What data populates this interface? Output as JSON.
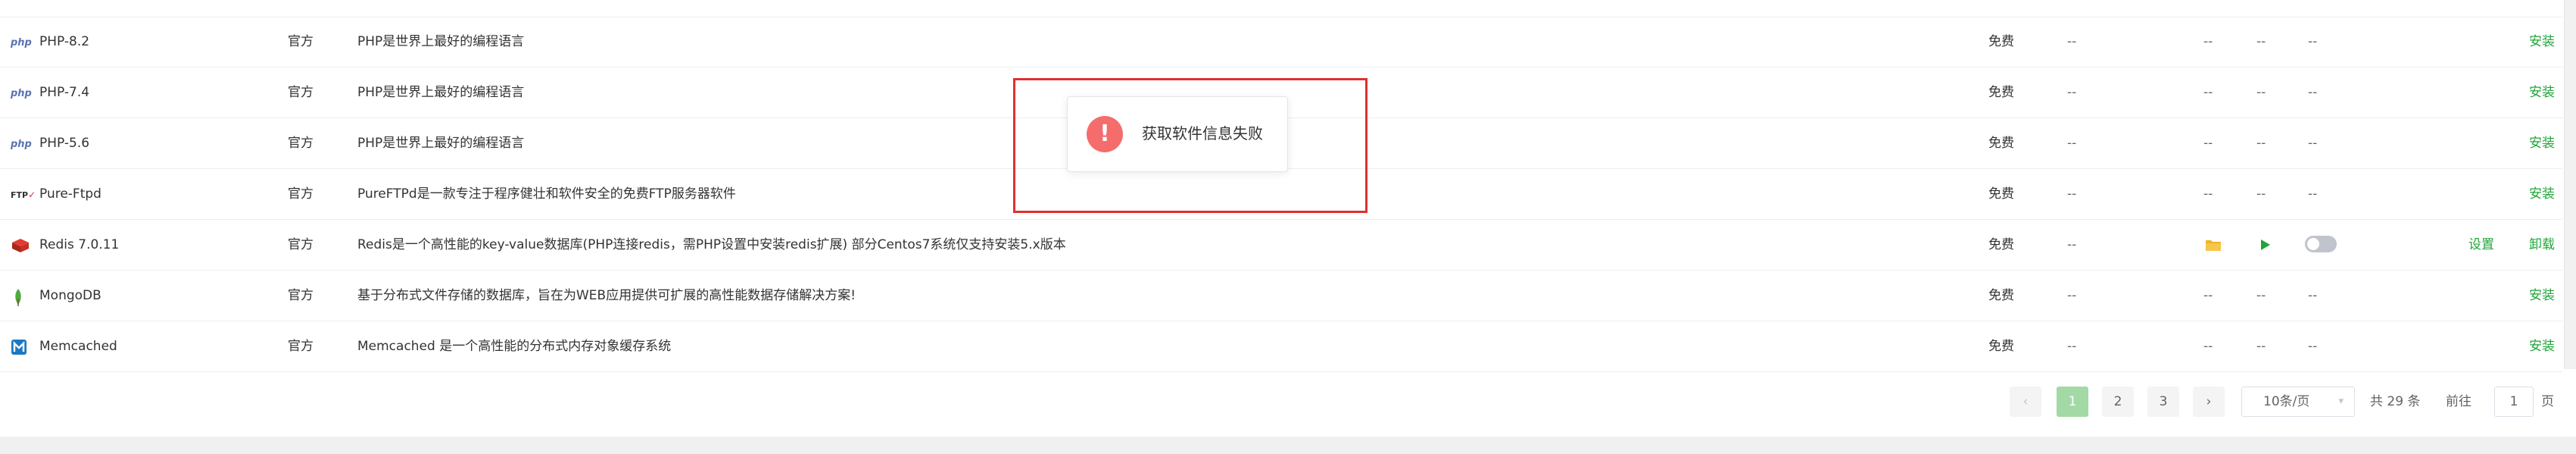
{
  "rows": [
    {
      "name": "PHP-8.2",
      "type": "官方",
      "desc": "PHP是世界上最好的编程语言",
      "price": "免费",
      "d1": "--",
      "d2": "--",
      "d3": "--",
      "d4": "--",
      "action": "安装",
      "icon": "php-icon"
    },
    {
      "name": "PHP-7.4",
      "type": "官方",
      "desc": "PHP是世界上最好的编程语言",
      "price": "免费",
      "d1": "--",
      "d2": "--",
      "d3": "--",
      "d4": "--",
      "action": "安装",
      "icon": "php-icon"
    },
    {
      "name": "PHP-5.6",
      "type": "官方",
      "desc": "PHP是世界上最好的编程语言",
      "price": "免费",
      "d1": "--",
      "d2": "--",
      "d3": "--",
      "d4": "--",
      "action": "安装",
      "icon": "php-icon"
    },
    {
      "name": "Pure-Ftpd",
      "type": "官方",
      "desc": "PureFTPd是一款专注于程序健壮和软件安全的免费FTP服务器软件",
      "price": "免费",
      "d1": "--",
      "d2": "--",
      "d3": "--",
      "d4": "--",
      "action": "安装",
      "icon": "ftp-icon"
    },
    {
      "name": "Redis 7.0.11",
      "type": "官方",
      "desc": "Redis是一个高性能的key-value数据库(PHP连接redis，需PHP设置中安装redis扩展) 部分Centos7系统仅支持安装5.x版本",
      "price": "免费",
      "d1": "--",
      "setting": "设置",
      "action": "卸载",
      "icon": "redis-icon"
    },
    {
      "name": "MongoDB",
      "type": "官方",
      "desc": "基于分布式文件存储的数据库，旨在为WEB应用提供可扩展的高性能数据存储解决方案!",
      "price": "免费",
      "d1": "--",
      "d2": "--",
      "d3": "--",
      "d4": "--",
      "action": "安装",
      "icon": "mongodb-icon"
    },
    {
      "name": "Memcached",
      "type": "官方",
      "desc": "Memcached 是一个高性能的分布式内存对象缓存系统",
      "price": "免费",
      "d1": "--",
      "d2": "--",
      "d3": "--",
      "d4": "--",
      "action": "安装",
      "icon": "memcached-icon"
    }
  ],
  "icons": {
    "php": "php",
    "ftp": "FTP"
  },
  "pagination": {
    "prev": "‹",
    "pages": [
      "1",
      "2",
      "3"
    ],
    "next": "›",
    "page_size": "10条/页",
    "total": "共 29 条",
    "goto_label": "前往",
    "goto_value": "1",
    "goto_suffix": "页"
  },
  "dialog": {
    "message": "获取软件信息失败",
    "icon": "!"
  },
  "colors": {
    "accent": "#20a53a",
    "error": "#f56c6c",
    "page_active": "#a3d9a5"
  }
}
